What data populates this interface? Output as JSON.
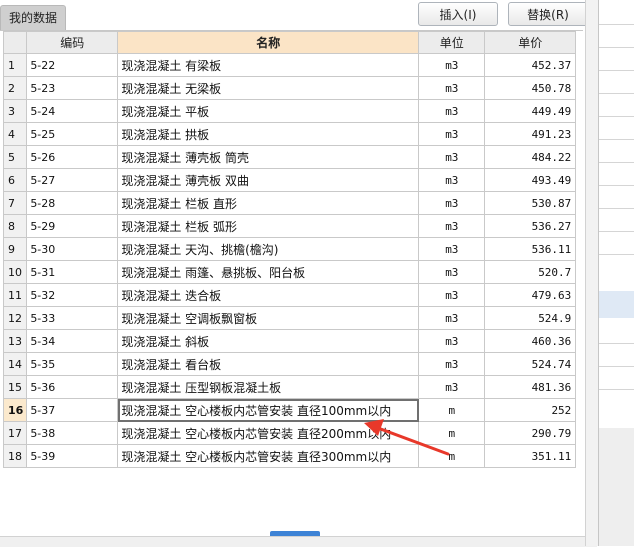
{
  "tab_label": "我的数据",
  "buttons": {
    "insert": "插入(I)",
    "replace": "替换(R)"
  },
  "columns": {
    "code": "编码",
    "name": "名称",
    "unit": "单位",
    "price": "单价"
  },
  "rows": [
    {
      "n": "1",
      "code": "5-22",
      "name": "现浇混凝土 有梁板",
      "unit": "m3",
      "price": "452.37"
    },
    {
      "n": "2",
      "code": "5-23",
      "name": "现浇混凝土 无梁板",
      "unit": "m3",
      "price": "450.78"
    },
    {
      "n": "3",
      "code": "5-24",
      "name": "现浇混凝土 平板",
      "unit": "m3",
      "price": "449.49"
    },
    {
      "n": "4",
      "code": "5-25",
      "name": "现浇混凝土 拱板",
      "unit": "m3",
      "price": "491.23"
    },
    {
      "n": "5",
      "code": "5-26",
      "name": "现浇混凝土 薄壳板 筒壳",
      "unit": "m3",
      "price": "484.22"
    },
    {
      "n": "6",
      "code": "5-27",
      "name": "现浇混凝土 薄壳板 双曲",
      "unit": "m3",
      "price": "493.49"
    },
    {
      "n": "7",
      "code": "5-28",
      "name": "现浇混凝土 栏板 直形",
      "unit": "m3",
      "price": "530.87"
    },
    {
      "n": "8",
      "code": "5-29",
      "name": "现浇混凝土 栏板 弧形",
      "unit": "m3",
      "price": "536.27"
    },
    {
      "n": "9",
      "code": "5-30",
      "name": "现浇混凝土 天沟、挑檐(檐沟)",
      "unit": "m3",
      "price": "536.11"
    },
    {
      "n": "10",
      "code": "5-31",
      "name": "现浇混凝土 雨篷、悬挑板、阳台板",
      "unit": "m3",
      "price": "520.7"
    },
    {
      "n": "11",
      "code": "5-32",
      "name": "现浇混凝土 迭合板",
      "unit": "m3",
      "price": "479.63"
    },
    {
      "n": "12",
      "code": "5-33",
      "name": "现浇混凝土 空调板飘窗板",
      "unit": "m3",
      "price": "524.9"
    },
    {
      "n": "13",
      "code": "5-34",
      "name": "现浇混凝土 斜板",
      "unit": "m3",
      "price": "460.36"
    },
    {
      "n": "14",
      "code": "5-35",
      "name": "现浇混凝土 看台板",
      "unit": "m3",
      "price": "524.74"
    },
    {
      "n": "15",
      "code": "5-36",
      "name": "现浇混凝土 压型钢板混凝土板",
      "unit": "m3",
      "price": "481.36"
    },
    {
      "n": "16",
      "code": "5-37",
      "name": "现浇混凝土 空心楼板内芯管安装 直径100mm以内",
      "unit": "m",
      "price": "252"
    },
    {
      "n": "17",
      "code": "5-38",
      "name": "现浇混凝土 空心楼板内芯管安装 直径200mm以内",
      "unit": "m",
      "price": "290.79"
    },
    {
      "n": "18",
      "code": "5-39",
      "name": "现浇混凝土 空心楼板内芯管安装 直径300mm以内",
      "unit": "m",
      "price": "351.11"
    }
  ],
  "selected_row": "16",
  "annotation_color": "#e8382a"
}
